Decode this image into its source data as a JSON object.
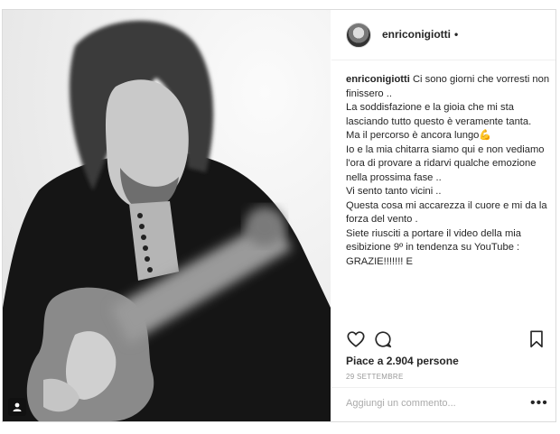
{
  "post": {
    "username": "enriconigiotti",
    "header_dot": "•",
    "caption_lines": [
      "Ci sono giorni che vorresti non finissero ..",
      "La soddisfazione e la gioia che mi sta lasciando tutto questo è veramente tanta.",
      "Ma il percorso è ancora lungo💪",
      "Io e la mia chitarra siamo qui e non vediamo l'ora di provare a ridarvi qualche emozione nella prossima fase ..",
      "Vi sento tanto vicini ..",
      "Questa cosa mi accarezza il cuore e mi da la forza del vento .",
      "Siete riusciti a portare il video della mia esibizione 9º in tendenza su YouTube : GRAZIE!!!!!!! E"
    ],
    "likes": "Piace a 2.904 persone",
    "date": "29 SETTEMBRE",
    "comment_placeholder": "Aggiungi un commento...",
    "more_label": "•••"
  },
  "icons": {
    "photo_badge": "user-tag-icon",
    "like": "heart-icon",
    "comment": "comment-bubble-icon",
    "save": "bookmark-icon"
  },
  "colors": {
    "text": "#262626",
    "muted": "#999999",
    "border": "#dbdbdb"
  }
}
